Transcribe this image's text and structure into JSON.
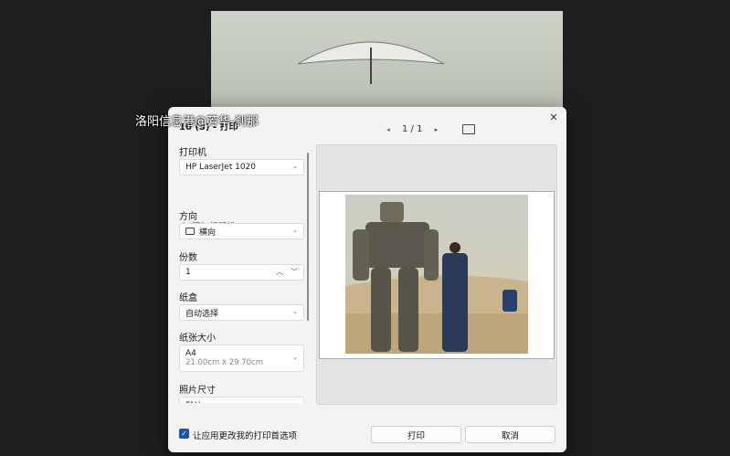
{
  "dialog": {
    "title": "10 (3) - 打印",
    "close_glyph": "✕"
  },
  "pager": {
    "prev_glyph": "◂",
    "page_indicator": "1 / 1",
    "next_glyph": "▸"
  },
  "settings": {
    "printer": {
      "label": "打印机",
      "value": "HP LaserJet 1020",
      "add_label": "添加打印机"
    },
    "orientation": {
      "label": "方向",
      "value": "横向"
    },
    "copies": {
      "label": "份数",
      "value": "1"
    },
    "tray": {
      "label": "纸盒",
      "value": "自动选择"
    },
    "paper_size": {
      "label": "纸张大小",
      "value": "A4",
      "dims": "21.00cm x 29.70cm"
    },
    "photo_size": {
      "label": "照片尺寸",
      "value": "默认"
    }
  },
  "watermark": "洛阳信息港@芳华-刹那",
  "footer": {
    "checkbox_label": "让应用更改我的打印首选项",
    "checkbox_checked": true,
    "print_button": "打印",
    "cancel_button": "取消"
  },
  "colors": {
    "accent": "#1a56b0",
    "backdrop": "#1e1e1e",
    "dialog_bg": "#f3f3f3"
  }
}
